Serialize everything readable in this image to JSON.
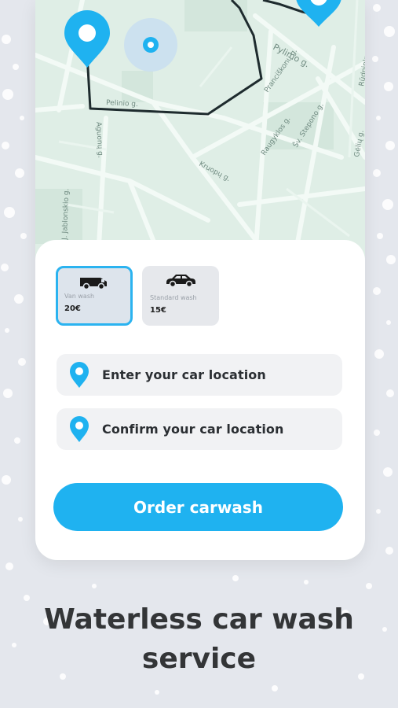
{
  "map": {
    "streets": [
      "Pylimo g.",
      "Pranciškonų g.",
      "Raugyklos g.",
      "Šv. Stepono g.",
      "Gėlių g.",
      "Rūdninkų g.",
      "Aguonų g.",
      "Kruopų g.",
      "Pelinio g.",
      "J. Jablonskio g."
    ]
  },
  "options": [
    {
      "name": "Van wash",
      "price": "20€",
      "icon": "van-icon",
      "selected": true
    },
    {
      "name": "Standard wash",
      "price": "15€",
      "icon": "car-icon",
      "selected": false
    }
  ],
  "location_fields": {
    "enter_label": "Enter your car location",
    "confirm_label": "Confirm your car location"
  },
  "order_button": {
    "label": "Order carwash"
  },
  "headline": {
    "line1": "Waterless car wash",
    "line2": "service"
  },
  "colors": {
    "accent": "#1fb2f0",
    "map_bg": "#dfeee6",
    "page_bg": "#e4e7ed"
  }
}
